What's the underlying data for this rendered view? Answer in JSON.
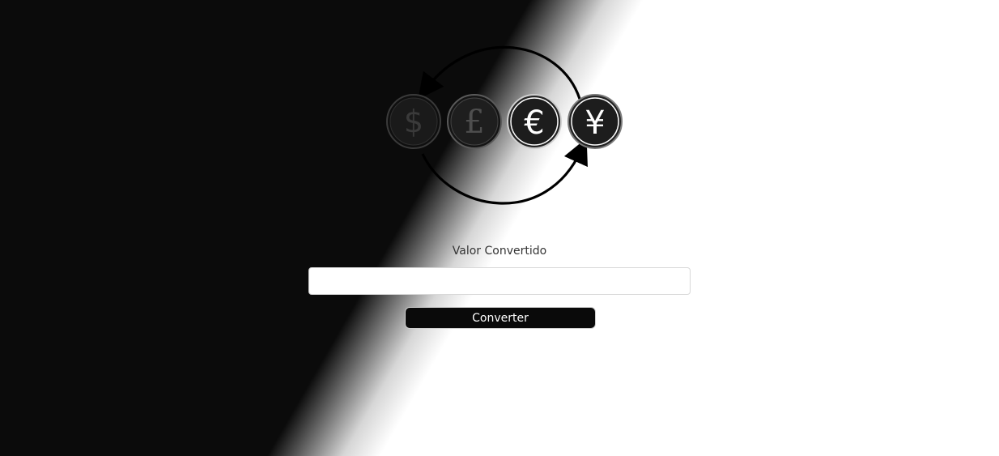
{
  "logo": {
    "symbols": [
      "$",
      "£",
      "€",
      "¥"
    ]
  },
  "converter": {
    "output_label": "Valor Convertido",
    "output_value": "",
    "button_label": "Converter"
  }
}
